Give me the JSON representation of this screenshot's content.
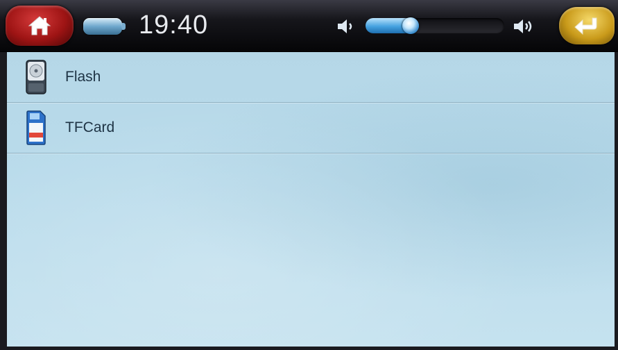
{
  "statusbar": {
    "time": "19:40",
    "volume_level": 0.3,
    "icons": {
      "home": "home-icon",
      "battery": "battery-icon",
      "volume_low": "volume-low-icon",
      "volume_high": "volume-high-icon",
      "back": "back-arrow-icon"
    }
  },
  "storage_list": {
    "items": [
      {
        "label": "Flash",
        "icon": "flash-disk-icon"
      },
      {
        "label": "TFCard",
        "icon": "sd-card-icon"
      }
    ]
  },
  "colors": {
    "home_button": "#b81e1e",
    "back_button": "#d4a82a",
    "volume_accent": "#3d9ee0",
    "list_background": "#b9dbeb"
  }
}
